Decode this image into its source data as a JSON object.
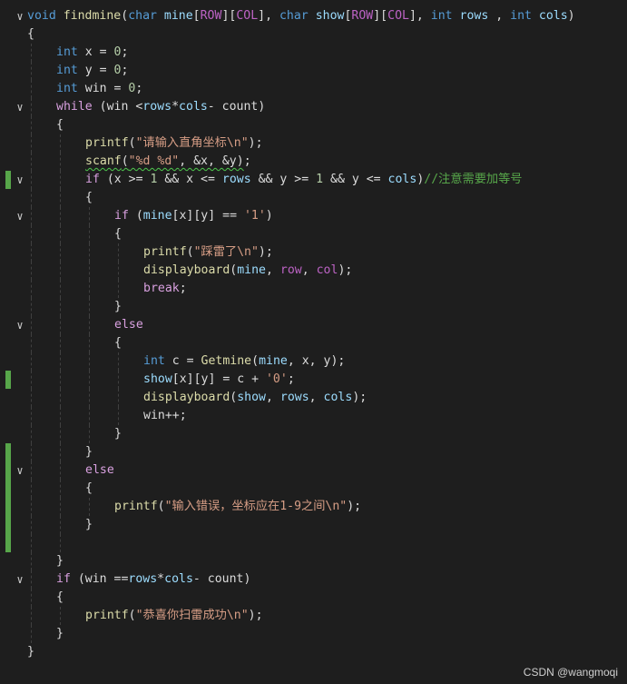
{
  "editor": {
    "lines": [
      {
        "fold": true,
        "mark": false,
        "indent": 0,
        "tokens": [
          [
            "kw",
            "void "
          ],
          [
            "fn",
            "findmine"
          ],
          [
            "p",
            "("
          ],
          [
            "kw",
            "char "
          ],
          [
            "par",
            "mine"
          ],
          [
            "p",
            "["
          ],
          [
            "mac",
            "ROW"
          ],
          [
            "p",
            "]["
          ],
          [
            "mac",
            "COL"
          ],
          [
            "p",
            "], "
          ],
          [
            "kw",
            "char "
          ],
          [
            "par",
            "show"
          ],
          [
            "p",
            "["
          ],
          [
            "mac",
            "ROW"
          ],
          [
            "p",
            "]["
          ],
          [
            "mac",
            "COL"
          ],
          [
            "p",
            "], "
          ],
          [
            "kw",
            "int "
          ],
          [
            "par",
            "rows "
          ],
          [
            "p",
            ", "
          ],
          [
            "kw",
            "int "
          ],
          [
            "par",
            "cols"
          ],
          [
            "p",
            ")"
          ]
        ]
      },
      {
        "fold": false,
        "mark": false,
        "indent": 0,
        "tokens": [
          [
            "p",
            "{"
          ]
        ]
      },
      {
        "fold": false,
        "mark": false,
        "indent": 1,
        "tokens": [
          [
            "kw",
            "int "
          ],
          [
            "p",
            "x = "
          ],
          [
            "num",
            "0"
          ],
          [
            "p",
            ";"
          ]
        ]
      },
      {
        "fold": false,
        "mark": false,
        "indent": 1,
        "tokens": [
          [
            "kw",
            "int "
          ],
          [
            "p",
            "y = "
          ],
          [
            "num",
            "0"
          ],
          [
            "p",
            ";"
          ]
        ]
      },
      {
        "fold": false,
        "mark": false,
        "indent": 1,
        "tokens": [
          [
            "kw",
            "int "
          ],
          [
            "p",
            "win = "
          ],
          [
            "num",
            "0"
          ],
          [
            "p",
            ";"
          ]
        ]
      },
      {
        "fold": true,
        "mark": false,
        "indent": 1,
        "tokens": [
          [
            "ctl",
            "while "
          ],
          [
            "p",
            "("
          ],
          [
            "p",
            "win <"
          ],
          [
            "par",
            "rows"
          ],
          [
            "p",
            "*"
          ],
          [
            "par",
            "cols"
          ],
          [
            "p",
            "- count)"
          ]
        ]
      },
      {
        "fold": false,
        "mark": false,
        "indent": 1,
        "tokens": [
          [
            "p",
            "{"
          ]
        ]
      },
      {
        "fold": false,
        "mark": false,
        "indent": 2,
        "tokens": [
          [
            "fn",
            "printf"
          ],
          [
            "p",
            "("
          ],
          [
            "str",
            "\"请输入直角坐标\\n\""
          ],
          [
            "p",
            ");"
          ]
        ]
      },
      {
        "fold": false,
        "mark": false,
        "indent": 2,
        "tokens": [
          [
            "fnsq",
            "scanf"
          ],
          [
            "psq",
            "("
          ],
          [
            "strsq",
            "\"%d %d\""
          ],
          [
            "psq",
            ", &x, &y)"
          ],
          [
            "p",
            ";"
          ]
        ]
      },
      {
        "fold": true,
        "mark": true,
        "indent": 2,
        "tokens": [
          [
            "ctl",
            "if "
          ],
          [
            "p",
            "(x >= "
          ],
          [
            "num",
            "1"
          ],
          [
            "p",
            " && x <= "
          ],
          [
            "par",
            "rows"
          ],
          [
            "p",
            " && y >= "
          ],
          [
            "num",
            "1"
          ],
          [
            "p",
            " && y <= "
          ],
          [
            "par",
            "cols"
          ],
          [
            "p",
            ")"
          ],
          [
            "cmt",
            "//注意需要加等号"
          ]
        ]
      },
      {
        "fold": false,
        "mark": false,
        "indent": 2,
        "tokens": [
          [
            "p",
            "{"
          ]
        ]
      },
      {
        "fold": true,
        "mark": false,
        "indent": 3,
        "tokens": [
          [
            "ctl",
            "if "
          ],
          [
            "p",
            "("
          ],
          [
            "par",
            "mine"
          ],
          [
            "p",
            "[x][y] == "
          ],
          [
            "str",
            "'1'"
          ],
          [
            "p",
            ")"
          ]
        ]
      },
      {
        "fold": false,
        "mark": false,
        "indent": 3,
        "tokens": [
          [
            "p",
            "{"
          ]
        ]
      },
      {
        "fold": false,
        "mark": false,
        "indent": 4,
        "tokens": [
          [
            "fn",
            "printf"
          ],
          [
            "p",
            "("
          ],
          [
            "str",
            "\"踩雷了\\n\""
          ],
          [
            "p",
            ");"
          ]
        ]
      },
      {
        "fold": false,
        "mark": false,
        "indent": 4,
        "tokens": [
          [
            "fn",
            "displayboard"
          ],
          [
            "p",
            "("
          ],
          [
            "par",
            "mine"
          ],
          [
            "p",
            ", "
          ],
          [
            "mac",
            "row"
          ],
          [
            "p",
            ", "
          ],
          [
            "mac",
            "col"
          ],
          [
            "p",
            ");"
          ]
        ]
      },
      {
        "fold": false,
        "mark": false,
        "indent": 4,
        "tokens": [
          [
            "ctl",
            "break"
          ],
          [
            "p",
            ";"
          ]
        ]
      },
      {
        "fold": false,
        "mark": false,
        "indent": 3,
        "tokens": [
          [
            "p",
            "}"
          ]
        ]
      },
      {
        "fold": true,
        "mark": false,
        "indent": 3,
        "tokens": [
          [
            "ctl",
            "else"
          ]
        ]
      },
      {
        "fold": false,
        "mark": false,
        "indent": 3,
        "tokens": [
          [
            "p",
            "{"
          ]
        ]
      },
      {
        "fold": false,
        "mark": false,
        "indent": 4,
        "tokens": [
          [
            "kw",
            "int "
          ],
          [
            "p",
            "c = "
          ],
          [
            "fn",
            "Getmine"
          ],
          [
            "p",
            "("
          ],
          [
            "par",
            "mine"
          ],
          [
            "p",
            ", x, y);"
          ]
        ]
      },
      {
        "fold": false,
        "mark": true,
        "indent": 4,
        "tokens": [
          [
            "par",
            "show"
          ],
          [
            "p",
            "[x][y] = c + "
          ],
          [
            "str",
            "'0'"
          ],
          [
            "p",
            ";"
          ]
        ]
      },
      {
        "fold": false,
        "mark": false,
        "indent": 4,
        "tokens": [
          [
            "fn",
            "displayboard"
          ],
          [
            "p",
            "("
          ],
          [
            "par",
            "show"
          ],
          [
            "p",
            ", "
          ],
          [
            "par",
            "rows"
          ],
          [
            "p",
            ", "
          ],
          [
            "par",
            "cols"
          ],
          [
            "p",
            ");"
          ]
        ]
      },
      {
        "fold": false,
        "mark": false,
        "indent": 4,
        "tokens": [
          [
            "p",
            "win++;"
          ]
        ]
      },
      {
        "fold": false,
        "mark": false,
        "indent": 3,
        "tokens": [
          [
            "p",
            "}"
          ]
        ]
      },
      {
        "fold": false,
        "mark": true,
        "indent": 2,
        "tokens": [
          [
            "p",
            "}"
          ]
        ]
      },
      {
        "fold": true,
        "mark": true,
        "indent": 2,
        "tokens": [
          [
            "ctl",
            "else"
          ]
        ]
      },
      {
        "fold": false,
        "mark": true,
        "indent": 2,
        "tokens": [
          [
            "p",
            "{"
          ]
        ]
      },
      {
        "fold": false,
        "mark": true,
        "indent": 3,
        "tokens": [
          [
            "fn",
            "printf"
          ],
          [
            "p",
            "("
          ],
          [
            "str",
            "\"输入错误，坐标应在1-9之间\\n\""
          ],
          [
            "p",
            ");"
          ]
        ]
      },
      {
        "fold": false,
        "mark": true,
        "indent": 2,
        "tokens": [
          [
            "p",
            "}"
          ]
        ]
      },
      {
        "fold": false,
        "mark": true,
        "indent": 2,
        "tokens": []
      },
      {
        "fold": false,
        "mark": false,
        "indent": 1,
        "tokens": [
          [
            "p",
            "}"
          ]
        ]
      },
      {
        "fold": true,
        "mark": false,
        "indent": 1,
        "tokens": [
          [
            "ctl",
            "if "
          ],
          [
            "p",
            "(win =="
          ],
          [
            "par",
            "rows"
          ],
          [
            "p",
            "*"
          ],
          [
            "par",
            "cols"
          ],
          [
            "p",
            "- count)"
          ]
        ]
      },
      {
        "fold": false,
        "mark": false,
        "indent": 1,
        "tokens": [
          [
            "p",
            "{"
          ]
        ]
      },
      {
        "fold": false,
        "mark": false,
        "indent": 2,
        "tokens": [
          [
            "fn",
            "printf"
          ],
          [
            "p",
            "("
          ],
          [
            "str",
            "\"恭喜你扫雷成功\\n\""
          ],
          [
            "p",
            ");"
          ]
        ]
      },
      {
        "fold": false,
        "mark": false,
        "indent": 1,
        "tokens": [
          [
            "p",
            "}"
          ]
        ]
      },
      {
        "fold": false,
        "mark": false,
        "indent": 0,
        "tokens": [
          [
            "p",
            "}"
          ]
        ]
      }
    ]
  },
  "watermark": "CSDN @wangmoqi"
}
